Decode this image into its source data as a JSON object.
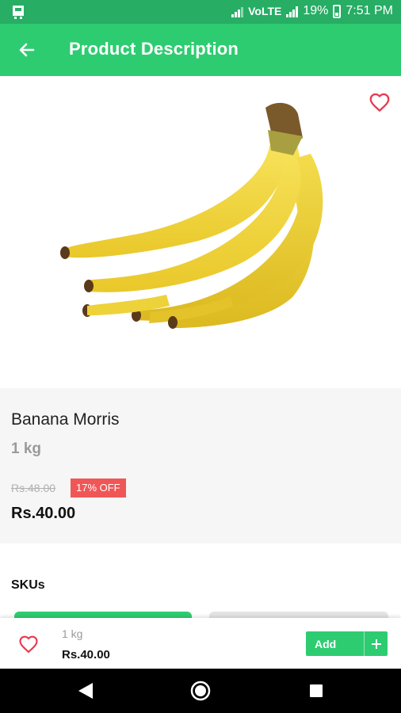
{
  "status_bar": {
    "network_label": "VoLTE",
    "battery": "19%",
    "time": "7:51 PM"
  },
  "app_bar": {
    "title": "Product Description",
    "back_icon": "arrow-left-icon"
  },
  "product": {
    "name": "Banana Morris",
    "unit": "1 kg",
    "mrp": "Rs.48.00",
    "discount": "17% OFF",
    "price": "Rs.40.00",
    "favorite_icon": "heart-outline-icon",
    "image": "banana-bunch-image"
  },
  "sku_section": {
    "title": "SKUs"
  },
  "cart_bar": {
    "unit": "1 kg",
    "price": "Rs.40.00",
    "add_label": "Add",
    "add_icon": "plus-icon"
  },
  "colors": {
    "primary": "#2ecc71",
    "status_bar": "#27ad64",
    "discount_badge": "#f05656",
    "heart": "#e53950"
  }
}
